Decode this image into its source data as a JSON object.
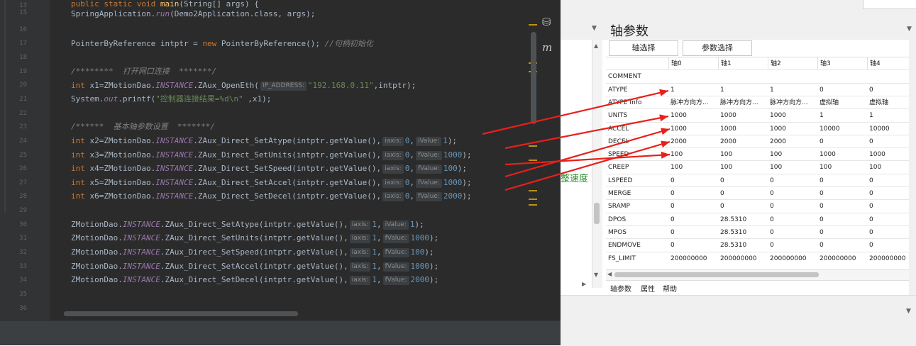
{
  "editor": {
    "line_numbers": [
      "13",
      "15",
      "16",
      "17",
      "18",
      "19",
      "20",
      "21",
      "22",
      "23",
      "24",
      "25",
      "26",
      "27",
      "28",
      "29",
      "30",
      "31",
      "32",
      "33",
      "34",
      "35",
      "36"
    ],
    "code": {
      "l13": [
        "public static void ",
        "main",
        "(String[] args) {"
      ],
      "l15": [
        "SpringApplication.",
        "run",
        "(Demo2Application.class, args);"
      ],
      "l17": [
        "PointerByReference intptr = ",
        "new",
        " PointerByReference(); ",
        "//句柄初始化"
      ],
      "l19": "/********  打开网口连接  *******/",
      "l20": [
        "int",
        " x1=ZMotionDao.",
        "INSTANCE",
        ".ZAux_OpenEth(",
        "IP_ADDRESS:",
        "\"192.168.0.11\"",
        ",intptr);"
      ],
      "l21": [
        "System.",
        "out",
        ".printf(",
        "\"控制器连接结果=%d\\n\"",
        " ,x1);"
      ],
      "l23": "/******  基本轴参数设置  *******/",
      "l24": [
        "int",
        " x2=ZMotionDao.",
        "INSTANCE",
        ".ZAux_Direct_SetAtype(intptr.getValue(),",
        "iaxis:",
        "0",
        ",",
        "iValue:",
        "1",
        ");"
      ],
      "l25": [
        "int",
        " x3=ZMotionDao.",
        "INSTANCE",
        ".ZAux_Direct_SetUnits(intptr.getValue(),",
        "iaxis:",
        "0",
        ",",
        "fValue:",
        "1000",
        ");"
      ],
      "l26": [
        "int",
        " x4=ZMotionDao.",
        "INSTANCE",
        ".ZAux_Direct_SetSpeed(intptr.getValue(),",
        "iaxis:",
        "0",
        ",",
        "fValue:",
        "100",
        ");"
      ],
      "l27": [
        "int",
        " x5=ZMotionDao.",
        "INSTANCE",
        ".ZAux_Direct_SetAccel(intptr.getValue(),",
        "iaxis:",
        "0",
        ",",
        "fValue:",
        "1000",
        ");"
      ],
      "l28": [
        "int",
        " x6=ZMotionDao.",
        "INSTANCE",
        ".ZAux_Direct_SetDecel(intptr.getValue(),",
        "iaxis:",
        "0",
        ",",
        "fValue:",
        "2000",
        ");"
      ],
      "l30": [
        "ZMotionDao.",
        "INSTANCE",
        ".ZAux_Direct_SetAtype(intptr.getValue(),",
        "iaxis:",
        "1",
        ",",
        "iValue:",
        "1",
        ");"
      ],
      "l31": [
        "ZMotionDao.",
        "INSTANCE",
        ".ZAux_Direct_SetUnits(intptr.getValue(),",
        "iaxis:",
        "1",
        ",",
        "fValue:",
        "1000",
        ");"
      ],
      "l32": [
        "ZMotionDao.",
        "INSTANCE",
        ".ZAux_Direct_SetSpeed(intptr.getValue(),",
        "iaxis:",
        "1",
        ",",
        "fValue:",
        "100",
        ");"
      ],
      "l33": [
        "ZMotionDao.",
        "INSTANCE",
        ".ZAux_Direct_SetAccel(intptr.getValue(),",
        "iaxis:",
        "1",
        ",",
        "fValue:",
        "1000",
        ");"
      ],
      "l34": [
        "ZMotionDao.",
        "INSTANCE",
        ".ZAux_Direct_SetDecel(intptr.getValue(),",
        "iaxis:",
        "1",
        ",",
        "fValue:",
        "2000",
        ");"
      ]
    },
    "side_icons": [
      "database-icon",
      "m"
    ]
  },
  "panel": {
    "title": "轴参数",
    "buttons": [
      "轴选择",
      "参数选择"
    ],
    "tree_green_text": "整速度",
    "columns": [
      "轴0",
      "轴1",
      "轴2",
      "轴3",
      "轴4"
    ],
    "rows": [
      {
        "name": "COMMENT",
        "values": [
          "",
          "",
          "",
          "",
          ""
        ]
      },
      {
        "name": "ATYPE",
        "values": [
          "1",
          "1",
          "1",
          "0",
          "0"
        ]
      },
      {
        "name": "ATYPE Info",
        "values": [
          "脉冲方向方...",
          "脉冲方向方...",
          "脉冲方向方...",
          "虚拟轴",
          "虚拟轴"
        ]
      },
      {
        "name": "UNITS",
        "values": [
          "1000",
          "1000",
          "1000",
          "1",
          "1"
        ]
      },
      {
        "name": "ACCEL",
        "values": [
          "1000",
          "1000",
          "1000",
          "10000",
          "10000"
        ]
      },
      {
        "name": "DECEL",
        "values": [
          "2000",
          "2000",
          "2000",
          "0",
          "0"
        ]
      },
      {
        "name": "SPEED",
        "values": [
          "100",
          "100",
          "100",
          "1000",
          "1000"
        ]
      },
      {
        "name": "CREEP",
        "values": [
          "100",
          "100",
          "100",
          "100",
          "100"
        ]
      },
      {
        "name": "LSPEED",
        "values": [
          "0",
          "0",
          "0",
          "0",
          "0"
        ]
      },
      {
        "name": "MERGE",
        "values": [
          "0",
          "0",
          "0",
          "0",
          "0"
        ]
      },
      {
        "name": "SRAMP",
        "values": [
          "0",
          "0",
          "0",
          "0",
          "0"
        ]
      },
      {
        "name": "DPOS",
        "values": [
          "0",
          "28.5310",
          "0",
          "0",
          "0"
        ]
      },
      {
        "name": "MPOS",
        "values": [
          "0",
          "28.5310",
          "0",
          "0",
          "0"
        ]
      },
      {
        "name": "ENDMOVE",
        "values": [
          "0",
          "28.5310",
          "0",
          "0",
          "0"
        ]
      },
      {
        "name": "FS_LIMIT",
        "values": [
          "200000000",
          "200000000",
          "200000000",
          "200000000",
          "200000000"
        ]
      }
    ],
    "tabs": [
      "轴参数",
      "属性",
      "帮助"
    ]
  },
  "colors": {
    "editor_bg": "#2b2b2b",
    "keyword": "#cc7832",
    "string": "#6a8759",
    "number": "#6897bb",
    "constant": "#9876aa",
    "arrow": "#e8201a"
  }
}
